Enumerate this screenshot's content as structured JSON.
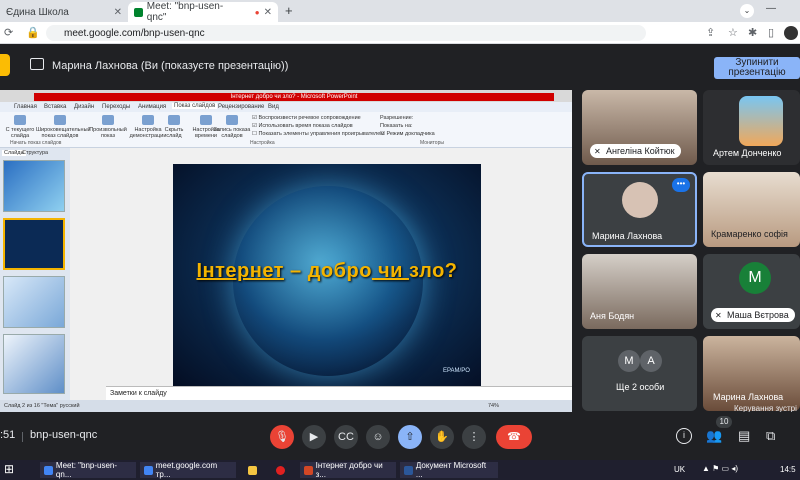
{
  "browser": {
    "tabs": [
      {
        "title": "Єдина Школа"
      },
      {
        "title": "Meet: \"bnp-usen-qnc\""
      }
    ],
    "url": "meet.google.com/bnp-usen-qnc"
  },
  "meet": {
    "presenting_label": "Марина Лахнова (Ви (показуєте презентацію))",
    "stop_button": "Зупинити презентацію",
    "meeting_code": "bnp-usen-qnc",
    "time": ":51",
    "participant_count": "10",
    "host_controls_label": "Керування зустрі",
    "participants": [
      {
        "name": "Ангеліна Койтюк"
      },
      {
        "name": "Артем Донченко"
      },
      {
        "name": "Марина Лахнова"
      },
      {
        "name": "Крамаренко софія"
      },
      {
        "name": "Аня Бодян"
      },
      {
        "name": "Маша Вєтрова",
        "initial": "М"
      },
      {
        "name": "Ще 2 особи",
        "initials": [
          "М",
          "А"
        ]
      },
      {
        "name": "Марина Лахнова"
      }
    ],
    "accent": "#8ab4f8",
    "leave_color": "#ea4335"
  },
  "powerpoint": {
    "title_bar": "Інтернет добро чи зло? - Microsoft PowerPoint",
    "ribbon_tabs": [
      "Главная",
      "Вставка",
      "Дизайн",
      "Переходы",
      "Анимация",
      "Показ слайдов",
      "Рецензирование",
      "Вид"
    ],
    "ribbon_items": [
      "С текущего слайда",
      "Широковещательный показ слайдов",
      "Произвольный показ",
      "Настройка демонстрации",
      "Скрыть слайд",
      "Настройка времени",
      "Запись показа слайдов"
    ],
    "ribbon_checks": [
      "Воспроизвести речевое сопровождение",
      "Использовать время показа слайдов",
      "Показать элементы управления проигрывателем"
    ],
    "ribbon_groups": [
      "Начать показ слайдов",
      "Настройка",
      "Мониторы"
    ],
    "monitor": [
      "Разрешение:",
      "Показать на:",
      "Режим докладчика"
    ],
    "left_tabs": [
      "Слайды",
      "Структура"
    ],
    "slide_text": {
      "part1": "Інтернет",
      "dash": " – ",
      "part2": "добро",
      "part3": " чи ",
      "part4": "зло?"
    },
    "slide_credit": "EPAM/PO",
    "notes_placeholder": "Заметки к слайду",
    "status": "Слайд 2 из 16    \"Тема\"    русский",
    "zoom": "74%"
  },
  "taskbar": {
    "items": [
      "Meet: \"bnp-usen-qn...",
      "meet.google.com тр...",
      "",
      "",
      "Інтернет добро чи з...",
      "Документ Microsoft ..."
    ],
    "lang": "UK",
    "clock": "14:5"
  },
  "icons": [
    "present-icon",
    "mic-off-icon",
    "camera-icon",
    "captions-icon",
    "emoji-icon",
    "present-now-icon",
    "raise-hand-icon",
    "more-icon",
    "leave-call-icon",
    "info-icon",
    "people-icon",
    "chat-icon",
    "activities-icon"
  ]
}
